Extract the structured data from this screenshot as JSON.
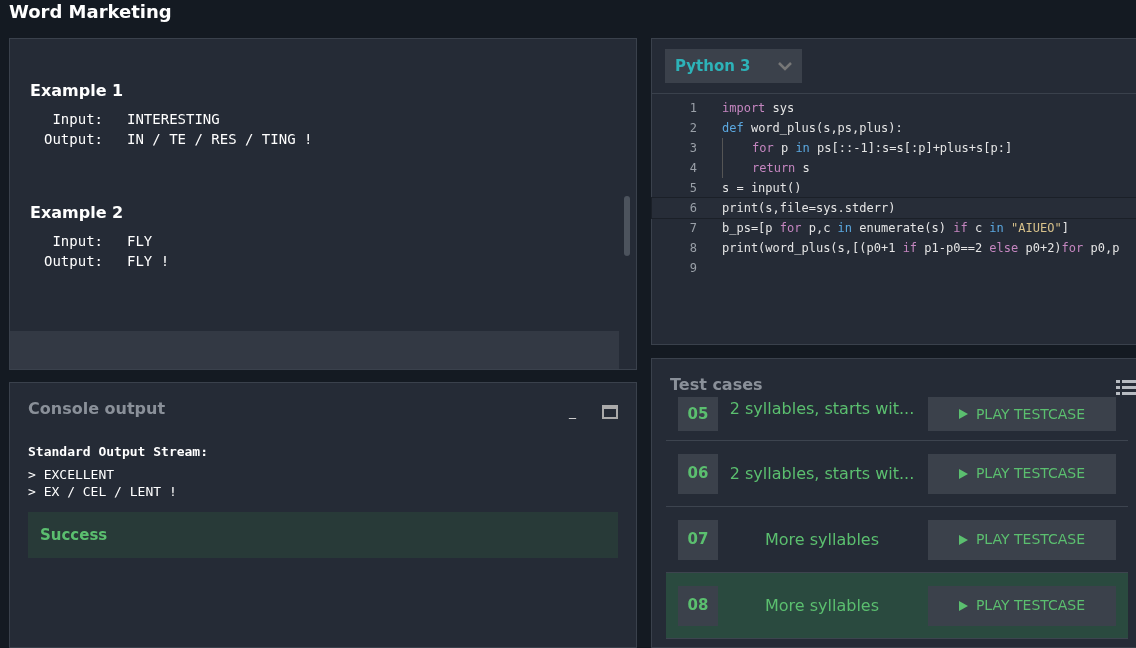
{
  "window": {
    "title": "Word Marketing"
  },
  "examples": [
    {
      "title": "Example 1",
      "rows": [
        {
          "label": "Input:",
          "value": "INTERESTING"
        },
        {
          "label": "Output:",
          "value": "IN / TE / RES / TING !"
        }
      ]
    },
    {
      "title": "Example 2",
      "rows": [
        {
          "label": "Input:",
          "value": "FLY"
        },
        {
          "label": "Output:",
          "value": "FLY !"
        }
      ]
    }
  ],
  "console": {
    "title": "Console output",
    "minimize": "_",
    "stream_title": "Standard Output Stream:",
    "lines": [
      "> EXCELLENT",
      "> EX / CEL / LENT !"
    ],
    "status": "Success"
  },
  "editor": {
    "language": "Python 3",
    "lines": [
      {
        "number": "1",
        "current": false,
        "indent": false,
        "tokens": [
          {
            "kind": "kw",
            "text": "import"
          },
          {
            "kind": "plain",
            "text": " sys"
          }
        ]
      },
      {
        "number": "2",
        "current": false,
        "indent": false,
        "tokens": [
          {
            "kind": "def",
            "text": "def"
          },
          {
            "kind": "plain",
            "text": " word_plus(s,ps,plus):"
          }
        ]
      },
      {
        "number": "3",
        "current": false,
        "indent": true,
        "tokens": [
          {
            "kind": "kw",
            "text": "for"
          },
          {
            "kind": "plain",
            "text": " p "
          },
          {
            "kind": "def",
            "text": "in"
          },
          {
            "kind": "plain",
            "text": " ps[::-1]:s=s[:p]+plus+s[p:]"
          }
        ]
      },
      {
        "number": "4",
        "current": false,
        "indent": true,
        "tokens": [
          {
            "kind": "kw",
            "text": "return"
          },
          {
            "kind": "plain",
            "text": " s"
          }
        ]
      },
      {
        "number": "5",
        "current": false,
        "indent": false,
        "tokens": [
          {
            "kind": "plain",
            "text": "s = input()"
          }
        ]
      },
      {
        "number": "6",
        "current": true,
        "indent": false,
        "tokens": [
          {
            "kind": "plain",
            "text": "print(s,file=sys.stderr)"
          }
        ]
      },
      {
        "number": "7",
        "current": false,
        "indent": false,
        "tokens": [
          {
            "kind": "plain",
            "text": "b_ps=[p "
          },
          {
            "kind": "kw",
            "text": "for"
          },
          {
            "kind": "plain",
            "text": " p,c "
          },
          {
            "kind": "def",
            "text": "in"
          },
          {
            "kind": "plain",
            "text": " enumerate(s) "
          },
          {
            "kind": "kw",
            "text": "if"
          },
          {
            "kind": "plain",
            "text": " c "
          },
          {
            "kind": "def",
            "text": "in "
          },
          {
            "kind": "str",
            "text": "\"AIUEO\""
          },
          {
            "kind": "plain",
            "text": "]"
          }
        ]
      },
      {
        "number": "8",
        "current": false,
        "indent": false,
        "tokens": [
          {
            "kind": "plain",
            "text": "print(word_plus(s,[(p0+1 "
          },
          {
            "kind": "kw",
            "text": "if"
          },
          {
            "kind": "plain",
            "text": " p1-p0==2 "
          },
          {
            "kind": "kw",
            "text": "else"
          },
          {
            "kind": "plain",
            "text": " p0+2)"
          },
          {
            "kind": "kw",
            "text": "for"
          },
          {
            "kind": "plain",
            "text": " p0,p"
          }
        ]
      },
      {
        "number": "9",
        "current": false
      }
    ]
  },
  "testcases": {
    "title": "Test cases",
    "items": [
      {
        "number": "05",
        "label": "2 syllables, starts wit...",
        "button": "PLAY TESTCASE",
        "selected": false
      },
      {
        "number": "06",
        "label": "2 syllables, starts wit...",
        "button": "PLAY TESTCASE",
        "selected": false
      },
      {
        "number": "07",
        "label": "More syllables",
        "button": "PLAY TESTCASE",
        "selected": false
      },
      {
        "number": "08",
        "label": "More syllables",
        "button": "PLAY TESTCASE",
        "selected": true
      }
    ]
  }
}
